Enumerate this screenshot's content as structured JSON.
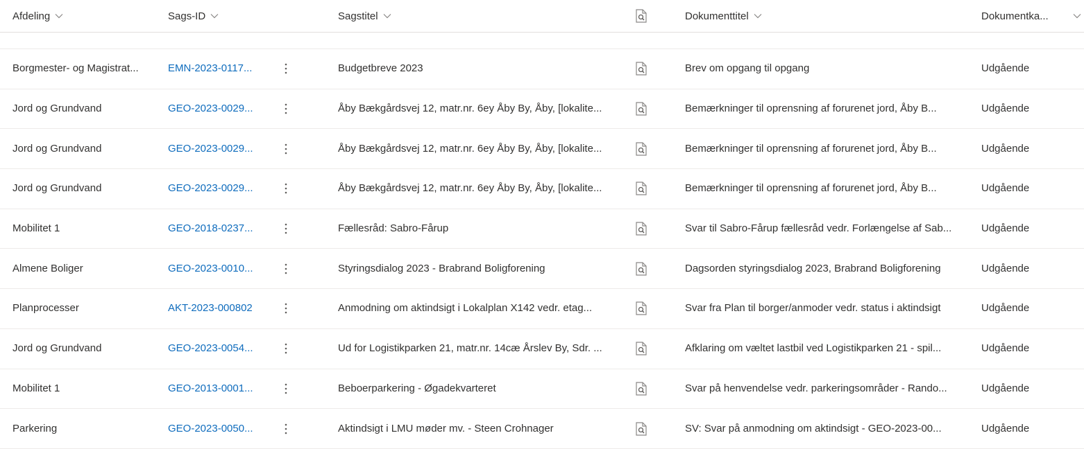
{
  "header": {
    "columns": [
      {
        "label": "Afdeling"
      },
      {
        "label": "Sags-ID"
      },
      {
        "label": "Sagstitel"
      },
      {
        "label": ""
      },
      {
        "label": "Dokumenttitel"
      },
      {
        "label": "Dokumentka..."
      }
    ],
    "doc_icon": "document-search-icon",
    "sort_icon": "chevron-down-icon"
  },
  "rows": [
    {
      "afdeling": "Borgmester- og Magistrat...",
      "sags_id": "EMN-2023-0117...",
      "sagstitel": "Budgetbreve 2023",
      "dokumenttitel": "Brev om opgang til opgang",
      "dokumentkategori": "Udgående"
    },
    {
      "afdeling": "Jord og Grundvand",
      "sags_id": "GEO-2023-0029...",
      "sagstitel": "Åby Bækgårdsvej 12, matr.nr. 6ey Åby By, Åby, [lokalite...",
      "dokumenttitel": "Bemærkninger til oprensning af forurenet jord, Åby B...",
      "dokumentkategori": "Udgående"
    },
    {
      "afdeling": "Jord og Grundvand",
      "sags_id": "GEO-2023-0029...",
      "sagstitel": "Åby Bækgårdsvej 12, matr.nr. 6ey Åby By, Åby, [lokalite...",
      "dokumenttitel": "Bemærkninger til oprensning af forurenet jord, Åby B...",
      "dokumentkategori": "Udgående"
    },
    {
      "afdeling": "Jord og Grundvand",
      "sags_id": "GEO-2023-0029...",
      "sagstitel": "Åby Bækgårdsvej 12, matr.nr. 6ey Åby By, Åby, [lokalite...",
      "dokumenttitel": "Bemærkninger til oprensning af forurenet jord, Åby B...",
      "dokumentkategori": "Udgående"
    },
    {
      "afdeling": "Mobilitet 1",
      "sags_id": "GEO-2018-0237...",
      "sagstitel": "Fællesråd: Sabro-Fårup",
      "dokumenttitel": "Svar til Sabro-Fårup fællesråd vedr. Forlængelse af Sab...",
      "dokumentkategori": "Udgående"
    },
    {
      "afdeling": "Almene Boliger",
      "sags_id": "GEO-2023-0010...",
      "sagstitel": "Styringsdialog 2023 - Brabrand Boligforening",
      "dokumenttitel": "Dagsorden styringsdialog 2023, Brabrand Boligforening",
      "dokumentkategori": "Udgående"
    },
    {
      "afdeling": "Planprocesser",
      "sags_id": "AKT-2023-000802",
      "sagstitel": "Anmodning om aktindsigt i Lokalplan X142 vedr. etag...",
      "dokumenttitel": "Svar fra Plan til borger/anmoder vedr. status i aktindsigt",
      "dokumentkategori": "Udgående"
    },
    {
      "afdeling": "Jord og Grundvand",
      "sags_id": "GEO-2023-0054...",
      "sagstitel": "Ud for Logistikparken 21, matr.nr. 14cæ Årslev By, Sdr. ...",
      "dokumenttitel": "Afklaring om væltet lastbil ved Logistikparken 21 - spil...",
      "dokumentkategori": "Udgående"
    },
    {
      "afdeling": "Mobilitet 1",
      "sags_id": "GEO-2013-0001...",
      "sagstitel": "Beboerparkering - Øgadekvarteret",
      "dokumenttitel": "Svar på henvendelse vedr. parkeringsområder - Rando...",
      "dokumentkategori": "Udgående"
    },
    {
      "afdeling": "Parkering",
      "sags_id": "GEO-2023-0050...",
      "sagstitel": "Aktindsigt i LMU møder mv. - Steen Crohnager",
      "dokumenttitel": "SV: Svar på anmodning om aktindsigt - GEO-2023-00...",
      "dokumentkategori": "Udgående"
    }
  ]
}
